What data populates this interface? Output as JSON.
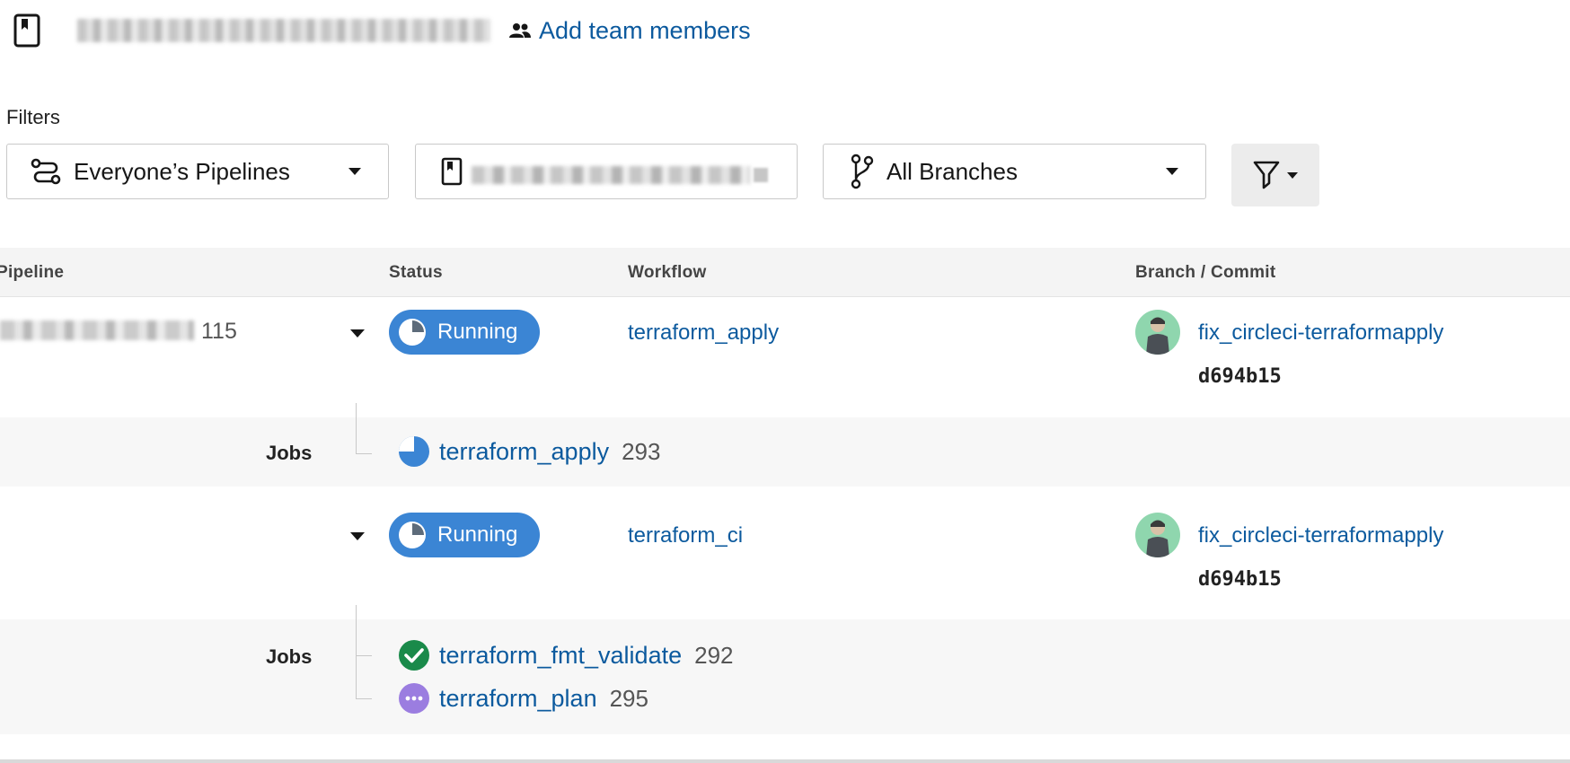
{
  "header": {
    "repo_icon": "bookmark-icon",
    "add_team_label": "Add team members",
    "people_icon": "people-icon"
  },
  "filters": {
    "label": "Filters",
    "pipelines_dropdown": {
      "value": "Everyone’s Pipelines",
      "icon": "pipeline-icon"
    },
    "project_dropdown": {
      "icon": "bookmark-icon"
    },
    "branches_dropdown": {
      "value": "All Branches",
      "icon": "branch-icon"
    },
    "filter_button_icon": "funnel-icon"
  },
  "table": {
    "columns": {
      "pipeline": "Pipeline",
      "status": "Status",
      "workflow": "Workflow",
      "branch_commit": "Branch / Commit"
    },
    "pipeline_number": "115",
    "workflows": [
      {
        "status": "Running",
        "workflow": "terraform_apply",
        "branch": "fix_circleci-terraformapply",
        "commit": "d694b15",
        "jobs_label": "Jobs",
        "jobs": [
          {
            "name": "terraform_apply",
            "number": "293",
            "state": "running"
          }
        ]
      },
      {
        "status": "Running",
        "workflow": "terraform_ci",
        "branch": "fix_circleci-terraformapply",
        "commit": "d694b15",
        "jobs_label": "Jobs",
        "jobs": [
          {
            "name": "terraform_fmt_validate",
            "number": "292",
            "state": "success"
          },
          {
            "name": "terraform_plan",
            "number": "295",
            "state": "queued"
          }
        ]
      }
    ]
  },
  "colors": {
    "link": "#0c5a9e",
    "running": "#3b85d4",
    "success": "#1a8a4a",
    "queued": "#9b7de0",
    "avatar_bg": "#8fd6ae"
  }
}
